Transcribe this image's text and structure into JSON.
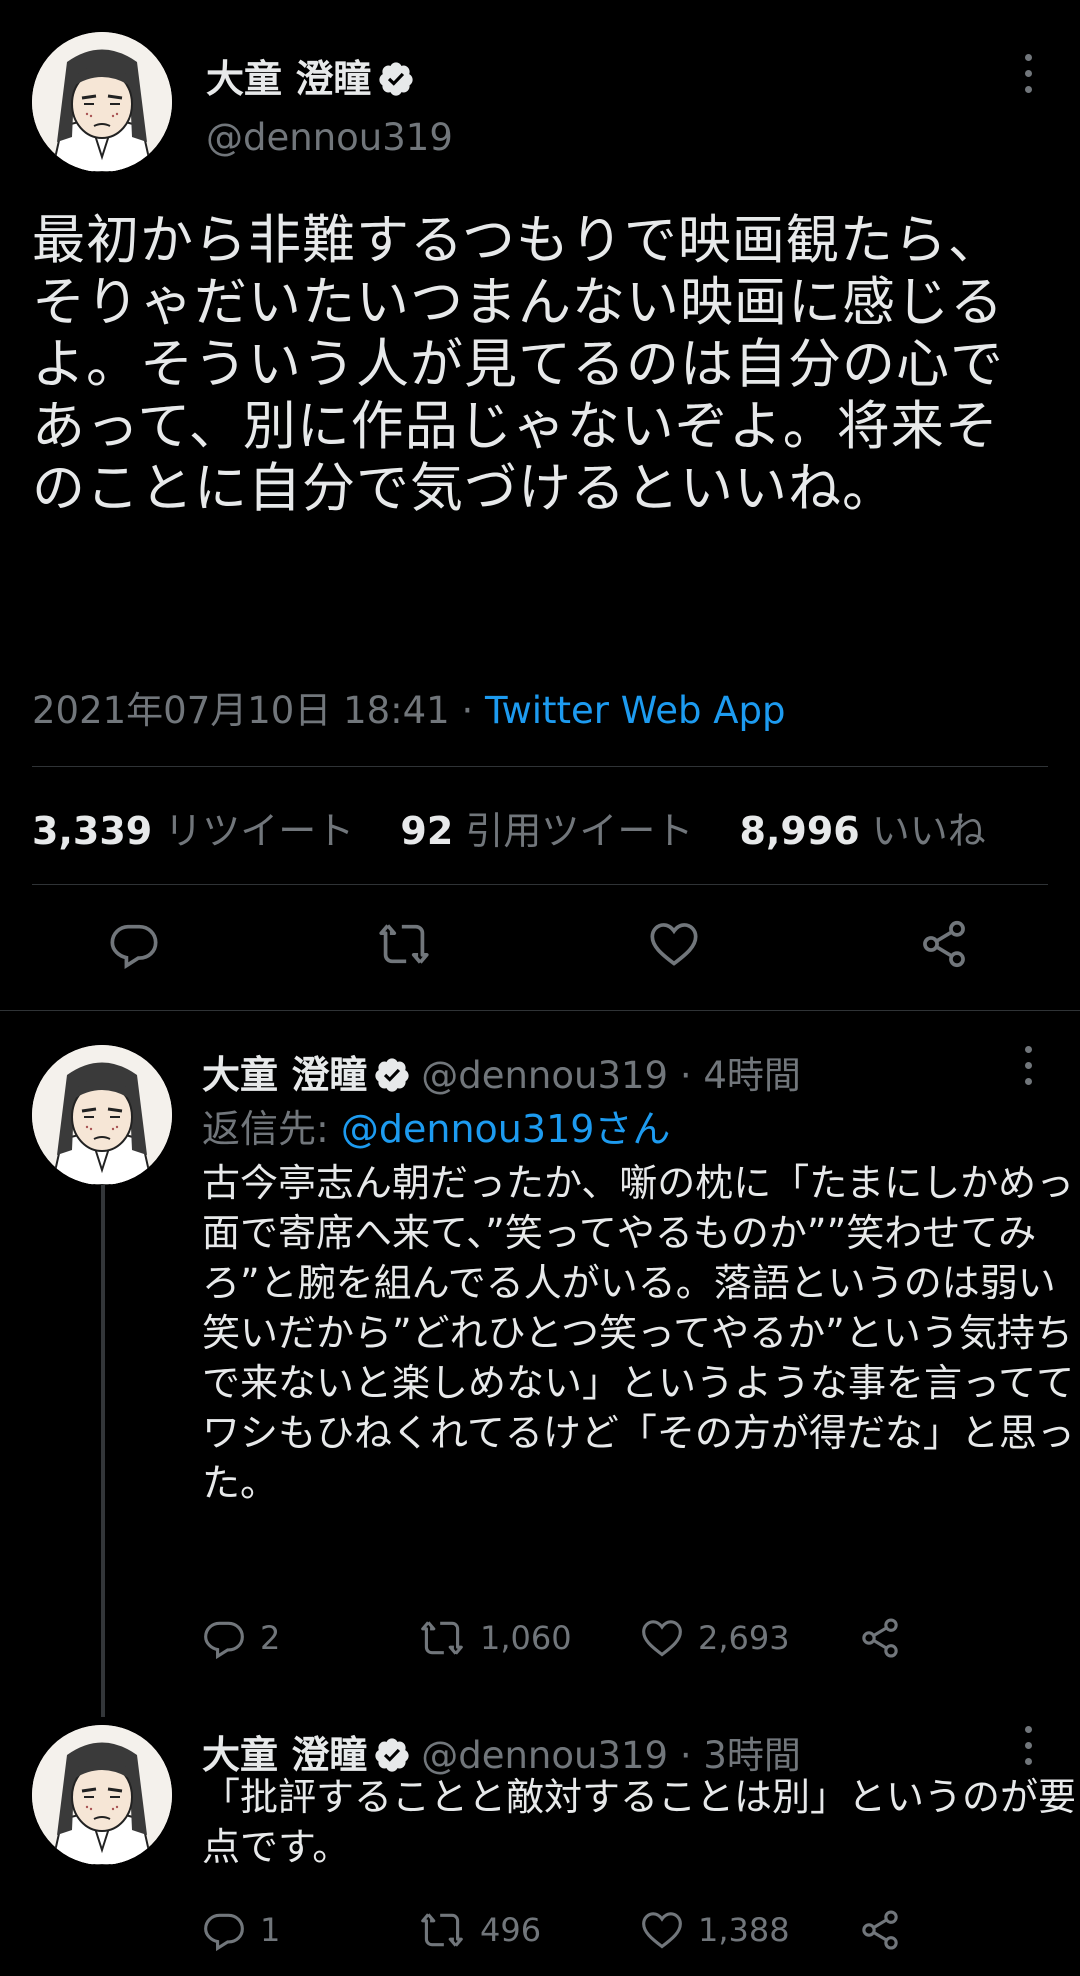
{
  "main_tweet": {
    "display_name": "大童 澄瞳",
    "handle": "@dennou319",
    "text": "最初から非難するつもりで映画観たら、そりゃだいたいつまんない映画に感じるよ。そういう人が見てるのは自分の心であって、別に作品じゃないぞよ。将来そのことに自分で気づけるといいね。",
    "timestamp": "2021年07月10日 18:41",
    "separator": " · ",
    "client": "Twitter Web App",
    "retweets_count": "3,339",
    "retweets_label": "リツイート",
    "quotes_count": "92",
    "quotes_label": "引用ツイート",
    "likes_count": "8,996",
    "likes_label": "いいね",
    "actions": [
      "reply-icon",
      "retweet-icon",
      "like-icon",
      "share-icon"
    ]
  },
  "replies": [
    {
      "display_name": "大童 澄瞳",
      "handle_time": "@dennou319 · 4時間",
      "reply_to_label": "返信先: ",
      "reply_to_mention": "@dennou319さん",
      "text": "古今亭志ん朝だったか、噺の枕に「たまにしかめっ面で寄席へ来て、”笑ってやるものか””笑わせてみろ”と腕を組んでる人がいる。落語というのは弱い笑いだから”どれひとつ笑ってやるか”という気持ちで来ないと楽しめない」というような事を言っててワシもひねくれてるけど「その方が得だな」と思った。",
      "reply_count": "2",
      "retweet_count": "1,060",
      "like_count": "2,693"
    },
    {
      "display_name": "大童 澄瞳",
      "handle_time": "@dennou319 · 3時間",
      "text": "「批評することと敵対することは別」というのが要点です。",
      "reply_count": "1",
      "retweet_count": "496",
      "like_count": "1,388"
    }
  ],
  "colors": {
    "background": "#000000",
    "text": "#e7e9ea",
    "muted": "#71767b",
    "accent": "#1d9bf0",
    "divider": "#2f3336"
  }
}
